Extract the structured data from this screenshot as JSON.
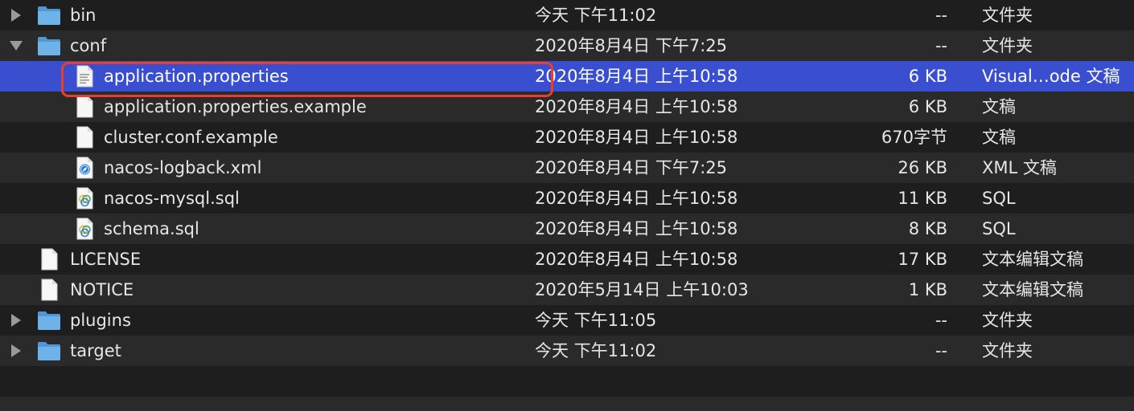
{
  "rows": [
    {
      "name": "bin",
      "date": "今天 下午11:02",
      "size": "--",
      "kind": "文件夹",
      "icon": "folder-icon",
      "disclosure": "collapsed"
    },
    {
      "name": "conf",
      "date": "2020年8月4日 下午7:25",
      "size": "--",
      "kind": "文件夹",
      "icon": "folder-icon",
      "disclosure": "expanded"
    },
    {
      "name": "application.properties",
      "date": "2020年8月4日 上午10:58",
      "size": "6 KB",
      "kind": "Visual…ode 文稿",
      "icon": "text-document-icon",
      "selected": true
    },
    {
      "name": "application.properties.example",
      "date": "2020年8月4日 上午10:58",
      "size": "6 KB",
      "kind": "文稿",
      "icon": "blank-document-icon"
    },
    {
      "name": "cluster.conf.example",
      "date": "2020年8月4日 上午10:58",
      "size": "670字节",
      "kind": "文稿",
      "icon": "blank-document-icon"
    },
    {
      "name": "nacos-logback.xml",
      "date": "2020年8月4日 下午7:25",
      "size": "26 KB",
      "kind": "XML 文稿",
      "icon": "xml-document-icon"
    },
    {
      "name": "nacos-mysql.sql",
      "date": "2020年8月4日 上午10:58",
      "size": "11 KB",
      "kind": "SQL",
      "icon": "sql-document-icon"
    },
    {
      "name": "schema.sql",
      "date": "2020年8月4日 上午10:58",
      "size": "8 KB",
      "kind": "SQL",
      "icon": "sql-document-icon"
    },
    {
      "name": "LICENSE",
      "date": "2020年8月4日 上午10:58",
      "size": "17 KB",
      "kind": "文本编辑文稿",
      "icon": "blank-document-icon"
    },
    {
      "name": "NOTICE",
      "date": "2020年5月14日 上午10:03",
      "size": "1 KB",
      "kind": "文本编辑文稿",
      "icon": "blank-document-icon"
    },
    {
      "name": "plugins",
      "date": "今天 下午11:05",
      "size": "--",
      "kind": "文件夹",
      "icon": "folder-icon",
      "disclosure": "collapsed"
    },
    {
      "name": "target",
      "date": "今天 下午11:02",
      "size": "--",
      "kind": "文件夹",
      "icon": "folder-icon",
      "disclosure": "collapsed"
    }
  ],
  "colors": {
    "background": "#1e1e1e",
    "alt_row": "#2a2a2a",
    "selection": "#3a4fcf",
    "highlight_outline": "#ec3d2b",
    "folder": "#5fa8e0"
  }
}
